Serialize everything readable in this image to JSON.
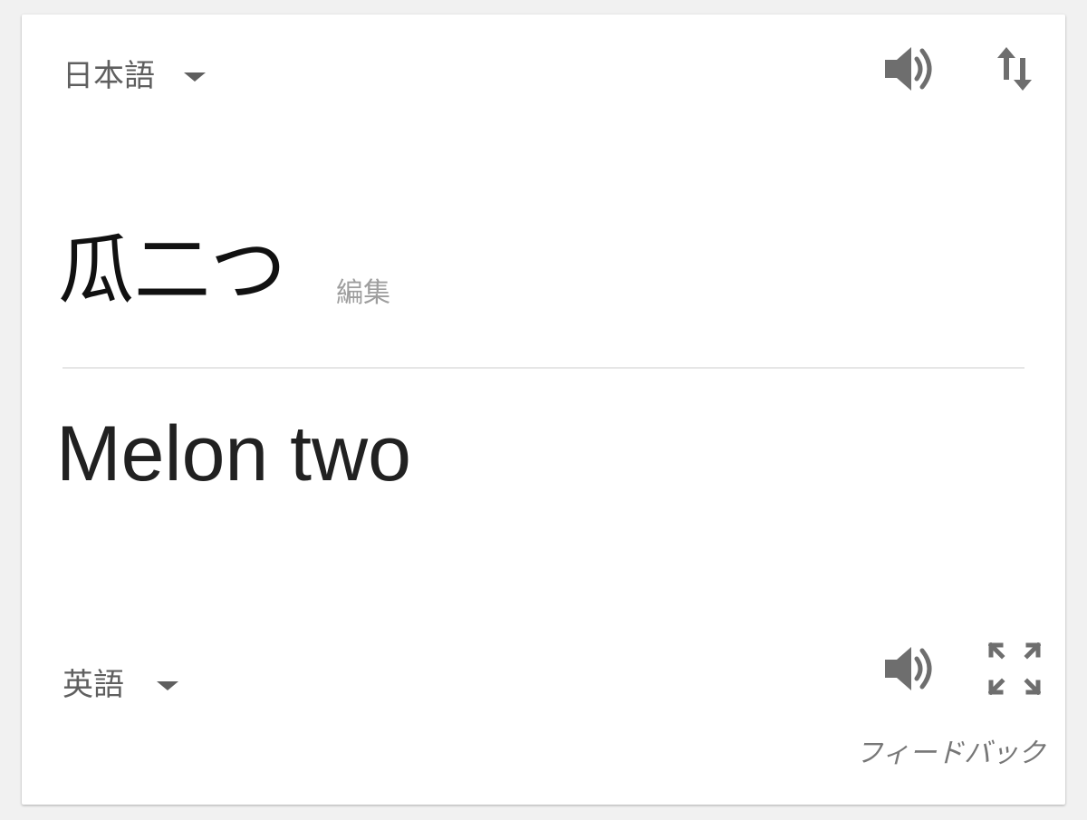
{
  "source": {
    "language": "日本語",
    "text": "瓜二つ",
    "edit_label": "編集"
  },
  "target": {
    "language": "英語",
    "text": "Melon two"
  },
  "feedback_label": "フィードバック",
  "icons": {
    "speaker": "speaker-icon",
    "swap": "swap-icon",
    "fullscreen": "fullscreen-icon",
    "dropdown": "caret-down-icon"
  },
  "colors": {
    "icon": "#6e6e6e",
    "text_primary": "#212121",
    "text_secondary": "#9e9e9e"
  }
}
